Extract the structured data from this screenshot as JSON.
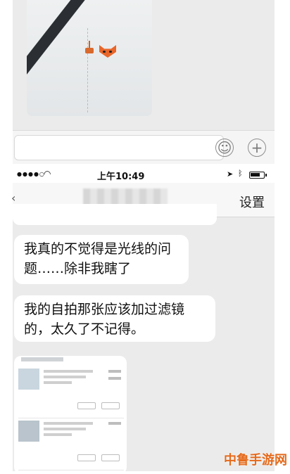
{
  "status_bar": {
    "time": "上午10:49"
  },
  "nav": {
    "settings_label": "设置"
  },
  "messages": [
    {
      "text": "我真的不觉得是光线的问题……除非我瞎了"
    },
    {
      "text": "我的自拍那张应该加过滤镜的，太久了不记得。"
    }
  ],
  "input": {
    "emoji_glyph": "☺",
    "plus_glyph": "+"
  },
  "icons": {
    "wifi": "wifi-icon",
    "location": "location-icon",
    "bluetooth": "bluetooth-icon",
    "battery": "battery-icon"
  },
  "watermark": "中鲁手游网"
}
